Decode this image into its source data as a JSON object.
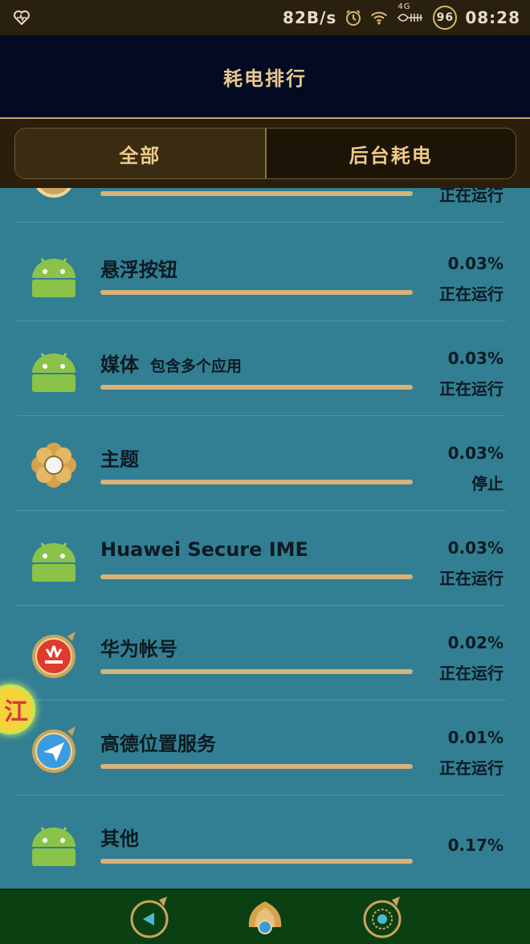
{
  "status_bar": {
    "net_speed": "82B/s",
    "network": "4G",
    "battery": "96",
    "time": "08:28",
    "icons": [
      "heart-monitor-icon",
      "alarm-icon",
      "wifi-icon",
      "signal-icon",
      "battery-icon"
    ]
  },
  "header": {
    "title": "耗电排行"
  },
  "tabs": [
    {
      "label": "全部",
      "active": true
    },
    {
      "label": "后台耗电",
      "active": false
    }
  ],
  "apps": [
    {
      "name": "",
      "percent": "",
      "status": "正在运行",
      "icon": "gold-app-icon"
    },
    {
      "name": "悬浮按钮",
      "percent": "0.03%",
      "status": "正在运行",
      "icon": "android-icon"
    },
    {
      "name": "媒体",
      "sub": "包含多个应用",
      "percent": "0.03%",
      "status": "正在运行",
      "icon": "android-icon"
    },
    {
      "name": "主题",
      "percent": "0.03%",
      "status": "停止",
      "icon": "theme-flower-icon"
    },
    {
      "name": "Huawei Secure IME",
      "percent": "0.03%",
      "status": "正在运行",
      "icon": "android-icon"
    },
    {
      "name": "华为帐号",
      "percent": "0.02%",
      "status": "正在运行",
      "icon": "huawei-id-icon"
    },
    {
      "name": "高德位置服务",
      "percent": "0.01%",
      "status": "正在运行",
      "icon": "amap-location-icon"
    },
    {
      "name": "其他",
      "percent": "0.17%",
      "status": "",
      "icon": "android-icon"
    }
  ],
  "floating_button": {
    "label": "江"
  },
  "bottom_nav": [
    {
      "icon": "back-icon"
    },
    {
      "icon": "home-icon"
    },
    {
      "icon": "recent-apps-icon"
    }
  ],
  "colors": {
    "list_bg": "#327f93",
    "header_bg": "#020b22",
    "accent_gold": "#d8b27a",
    "nav_bg": "#0b4012"
  }
}
